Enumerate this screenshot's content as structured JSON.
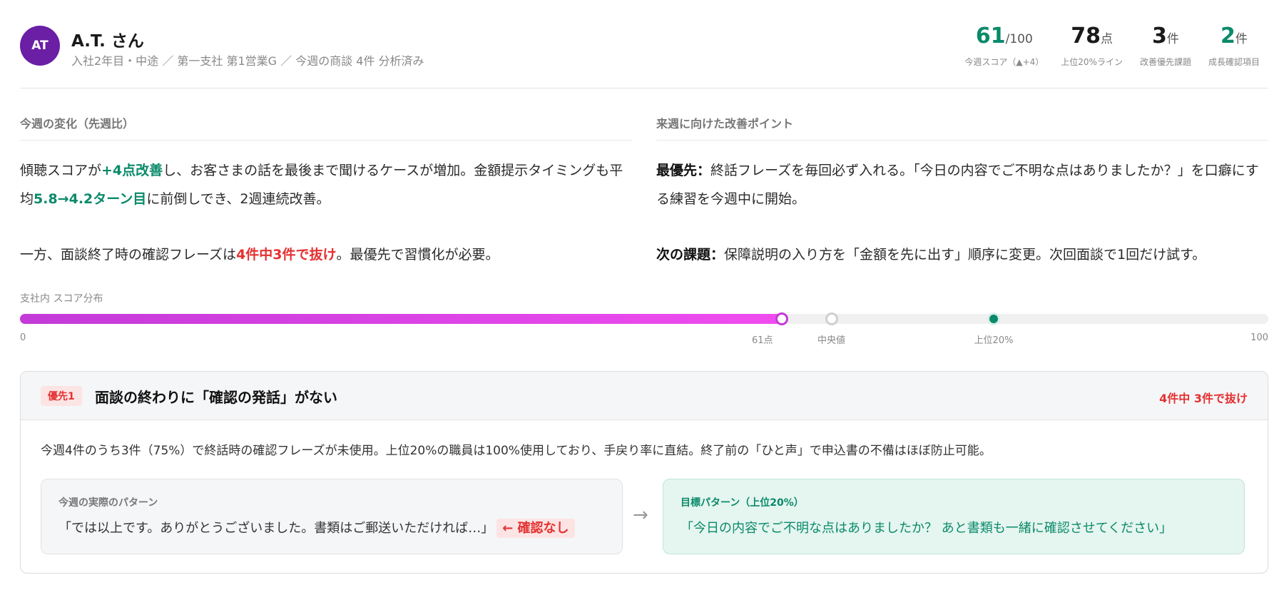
{
  "user": {
    "initials": "AT",
    "name": "A.T. さん",
    "meta": "入社2年目・中途 ／ 第一支社 第1営業G ／ 今週の商談 4件 分析済み"
  },
  "stats": [
    {
      "value": "61",
      "unit": "/100",
      "label": "今週スコア（▲+4）",
      "color": "green"
    },
    {
      "value": "78",
      "unit": "点",
      "label": "上位20%ライン",
      "color": "dark"
    },
    {
      "value": "3",
      "unit": "件",
      "label": "改善優先課題",
      "color": "dark"
    },
    {
      "value": "2",
      "unit": "件",
      "label": "成長確認項目",
      "color": "green"
    }
  ],
  "weekly_change": {
    "title": "今週の変化（先週比）",
    "p1_a": "傾聴スコアが",
    "p1_hl1": "+4点改善",
    "p1_b": "し、お客さまの話を最後まで聞けるケースが増加。金額提示タイミングも平均",
    "p1_hl2": "5.8→4.2ターン目",
    "p1_c": "に前倒しでき、2週連続改善。",
    "p2_a": "一方、面談終了時の確認フレーズは",
    "p2_hl": "4件中3件で抜け",
    "p2_b": "。最優先で習慣化が必要。"
  },
  "next_week": {
    "title": "来週に向けた改善ポイント",
    "p1_label": "最優先：",
    "p1_text": "終話フレーズを毎回必ず入れる。「今日の内容でご不明な点はありましたか？」を口癖にする練習を今週中に開始。",
    "p2_label": "次の課題：",
    "p2_text": "保障説明の入り方を「金額を先に出す」順序に変更。次回面談で1回だけ試す。"
  },
  "distribution": {
    "title": "支社内 スコア分布",
    "min_label": "0",
    "max_label": "100",
    "score": 61,
    "score_label": "61点",
    "median": 65,
    "median_label": "中央値",
    "top20": 78,
    "top20_label": "上位20%",
    "colors": {
      "fill_start": "#c33ad8",
      "fill_end": "#f04df0",
      "top": "#0a8a6a"
    }
  },
  "issue_card": {
    "badge": "優先1",
    "title": "面談の終わりに「確認の発話」がない",
    "status": "4件中 3件で抜け",
    "description": "今週4件のうち3件（75%）で終話時の確認フレーズが未使用。上位20%の職員は100%使用しており、手戻り率に直結。終了前の「ひと声」で申込書の不備はほぼ防止可能。",
    "current_label": "今週の実際のパターン",
    "current_text": "「では以上です。ありがとうございました。書類はご郵送いただければ…」",
    "current_tag": "← 確認なし",
    "arrow": "→",
    "target_label": "目標パターン（上位20%）",
    "target_text": "「今日の内容でご不明な点はありましたか？ あと書類も一緒に確認させてください」"
  }
}
